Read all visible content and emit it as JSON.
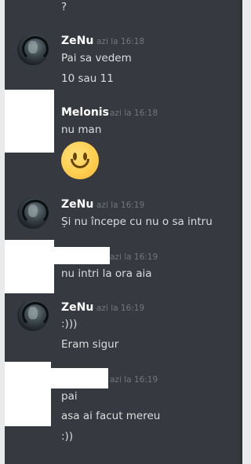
{
  "messages": [
    {
      "lines": [
        "?"
      ]
    },
    {
      "author": "ZeNu",
      "timestamp": "azi la 16:18",
      "lines": [
        "Pai sa vedem",
        "10 sau 11"
      ]
    },
    {
      "author": "Melonis",
      "timestamp": "azi la 16:18",
      "lines": [
        "nu man"
      ],
      "emoji": "slightly-smiling-face"
    },
    {
      "author": "ZeNu",
      "timestamp": "azi la 16:19",
      "lines": [
        "Și nu începe cu nu o sa intru"
      ]
    },
    {
      "timestamp": "azi la 16:19",
      "lines": [
        "nu intri la ora aia"
      ]
    },
    {
      "author": "ZeNu",
      "timestamp": "azi la 16:19",
      "lines": [
        ":)))",
        "Eram sigur"
      ]
    },
    {
      "timestamp": "azi la 16:19",
      "lines": [
        "pai",
        "asa ai facut mereu",
        ":))"
      ]
    }
  ],
  "colors": {
    "background": "#36393f",
    "author": "#ffffff",
    "text": "#dcddde",
    "timestamp": "#72767d",
    "redaction": "#ffffff"
  }
}
